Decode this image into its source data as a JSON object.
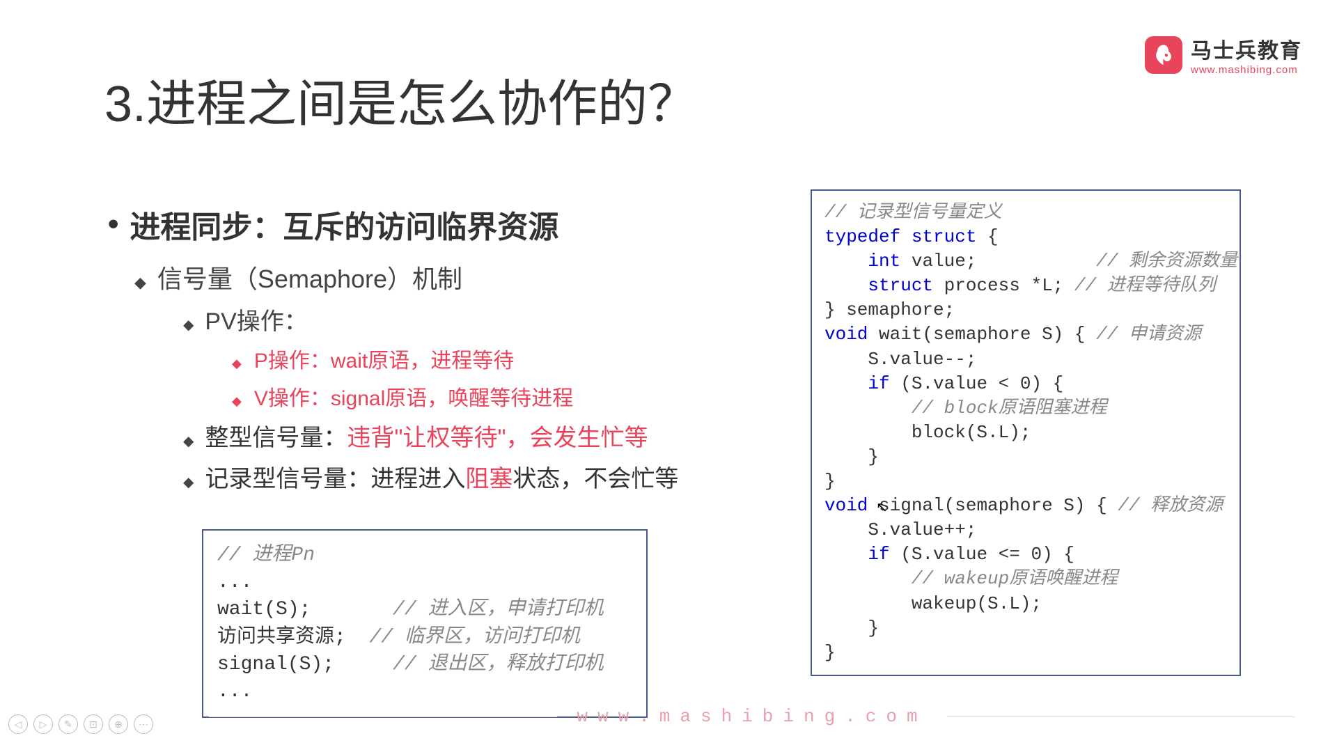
{
  "logo": {
    "title": "马士兵教育",
    "url": "www.mashibing.com"
  },
  "slide": {
    "title": "3.进程之间是怎么协作的？"
  },
  "content": {
    "main": "进程同步：互斥的访问临界资源",
    "l1_1": "信号量（Semaphore）机制",
    "l2_1": "PV操作：",
    "l3_1": "P操作：wait原语，进程等待",
    "l3_2": "V操作：signal原语，唤醒等待进程",
    "l2_2_prefix": "整型信号量：",
    "l2_2_red": "违背\"让权等待\"，会发生忙等",
    "l2_3_prefix": "记录型信号量：进程进入",
    "l2_3_red": "阻塞",
    "l2_3_suffix": "状态，不会忙等"
  },
  "code_left": {
    "line1_comment": "// 进程Pn",
    "line2": "...",
    "line3_code": "wait(S);",
    "line3_comment": "// 进入区，申请打印机",
    "line4_code": "访问共享资源;",
    "line4_comment": "// 临界区，访问打印机",
    "line5_code": "signal(S);",
    "line5_comment": "// 退出区，释放打印机",
    "line6": "..."
  },
  "code_right": {
    "c1": "// 记录型信号量定义",
    "kw_typedef": "typedef",
    "kw_struct": "struct",
    "brace_open": " {",
    "kw_int": "int",
    "val_field": " value;           ",
    "c2": "// 剩余资源数量",
    "kw_struct2": "struct",
    "proc_field": " process *L; ",
    "c3": "// 进程等待队列",
    "sem_close": "} semaphore;",
    "blank": "",
    "kw_void": "void",
    "wait_sig": " wait(semaphore S) { ",
    "c4": "// 申请资源",
    "w1": "    S.value--;",
    "kw_if": "if",
    "w2_cond": " (S.value < 0) {",
    "c5": "        // block原语阻塞进程",
    "w3": "        block(S.L);",
    "w4": "    }",
    "w5": "}",
    "signal_sig": " signal(semaphore S) { ",
    "c6": "// 释放资源",
    "s1": "    S.value++;",
    "s2_cond": " (S.value <= 0) {",
    "c7": "        // wakeup原语唤醒进程",
    "s3": "        wakeup(S.L);",
    "s4": "    }",
    "s5": "}"
  },
  "footer": {
    "url": "www.mashibing.com"
  },
  "controls": {
    "prev": "◁",
    "next": "▷",
    "pen": "✎",
    "camera": "⊡",
    "zoom": "⊕",
    "more": "⋯"
  }
}
